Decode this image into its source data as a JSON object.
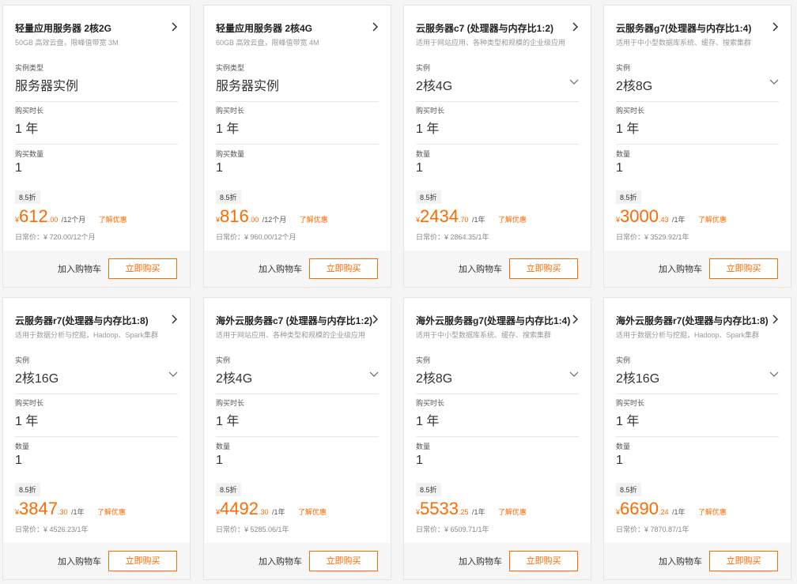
{
  "cards": [
    {
      "title": "轻量应用服务器 2核2G",
      "desc": "50GB 高效云盘，限峰值带宽 3M",
      "fields": [
        {
          "label": "实例类型",
          "value": "服务器实例",
          "dropdown": false
        },
        {
          "label": "购买时长",
          "value": "1 年",
          "dropdown": false
        },
        {
          "label": "购买数量",
          "value": "1",
          "dropdown": false
        }
      ],
      "discount": "8.5折",
      "currency": "¥",
      "price_int": "612",
      "price_dec": ".00",
      "period": "/12个月",
      "promo": "了解优惠",
      "orig": "日常价：¥ 720.00/12个月",
      "cart": "加入购物车",
      "buy": "立即购买"
    },
    {
      "title": "轻量应用服务器 2核4G",
      "desc": "60GB 高效云盘，限峰值带宽 4M",
      "fields": [
        {
          "label": "实例类型",
          "value": "服务器实例",
          "dropdown": false
        },
        {
          "label": "购买时长",
          "value": "1 年",
          "dropdown": false
        },
        {
          "label": "购买数量",
          "value": "1",
          "dropdown": false
        }
      ],
      "discount": "8.5折",
      "currency": "¥",
      "price_int": "816",
      "price_dec": ".00",
      "period": "/12个月",
      "promo": "了解优惠",
      "orig": "日常价：¥ 960.00/12个月",
      "cart": "加入购物车",
      "buy": "立即购买"
    },
    {
      "title": "云服务器c7 (处理器与内存比1:2)",
      "desc": "适用于网站应用、各种类型和规模的企业级应用",
      "fields": [
        {
          "label": "实例",
          "value": "2核4G",
          "dropdown": true
        },
        {
          "label": "购买时长",
          "value": "1 年",
          "dropdown": false
        },
        {
          "label": "数量",
          "value": "1",
          "dropdown": false
        }
      ],
      "discount": "8.5折",
      "currency": "¥",
      "price_int": "2434",
      "price_dec": ".70",
      "period": "/1年",
      "promo": "了解优惠",
      "orig": "日常价：¥ 2864.35/1年",
      "cart": "加入购物车",
      "buy": "立即购买"
    },
    {
      "title": "云服务器g7(处理器与内存比1:4)",
      "desc": "适用于中小型数据库系统、缓存、搜索集群",
      "fields": [
        {
          "label": "实例",
          "value": "2核8G",
          "dropdown": true
        },
        {
          "label": "购买时长",
          "value": "1 年",
          "dropdown": false
        },
        {
          "label": "数量",
          "value": "1",
          "dropdown": false
        }
      ],
      "discount": "8.5折",
      "currency": "¥",
      "price_int": "3000",
      "price_dec": ".43",
      "period": "/1年",
      "promo": "了解优惠",
      "orig": "日常价：¥ 3529.92/1年",
      "cart": "加入购物车",
      "buy": "立即购买"
    },
    {
      "title": "云服务器r7(处理器与内存比1:8)",
      "desc": "适用于数据分析与挖掘，Hadoop、Spark集群",
      "fields": [
        {
          "label": "实例",
          "value": "2核16G",
          "dropdown": true
        },
        {
          "label": "购买时长",
          "value": "1 年",
          "dropdown": false
        },
        {
          "label": "数量",
          "value": "1",
          "dropdown": false
        }
      ],
      "discount": "8.5折",
      "currency": "¥",
      "price_int": "3847",
      "price_dec": ".30",
      "period": "/1年",
      "promo": "了解优惠",
      "orig": "日常价：¥ 4526.23/1年",
      "cart": "加入购物车",
      "buy": "立即购买"
    },
    {
      "title": "海外云服务器c7 (处理器与内存比1:2)",
      "desc": "适用于网站应用、各种类型和规模的企业级应用",
      "fields": [
        {
          "label": "实例",
          "value": "2核4G",
          "dropdown": true
        },
        {
          "label": "购买时长",
          "value": "1 年",
          "dropdown": false
        },
        {
          "label": "数量",
          "value": "1",
          "dropdown": false
        }
      ],
      "discount": "8.5折",
      "currency": "¥",
      "price_int": "4492",
      "price_dec": ".30",
      "period": "/1年",
      "promo": "了解优惠",
      "orig": "日常价：¥ 5285.06/1年",
      "cart": "加入购物车",
      "buy": "立即购买"
    },
    {
      "title": "海外云服务器g7(处理器与内存比1:4)",
      "desc": "适用于中小型数据库系统、缓存、搜索集群",
      "fields": [
        {
          "label": "实例",
          "value": "2核8G",
          "dropdown": true
        },
        {
          "label": "购买时长",
          "value": "1 年",
          "dropdown": false
        },
        {
          "label": "数量",
          "value": "1",
          "dropdown": false
        }
      ],
      "discount": "8.5折",
      "currency": "¥",
      "price_int": "5533",
      "price_dec": ".25",
      "period": "/1年",
      "promo": "了解优惠",
      "orig": "日常价：¥ 6509.71/1年",
      "cart": "加入购物车",
      "buy": "立即购买"
    },
    {
      "title": "海外云服务器r7(处理器与内存比1:8)",
      "desc": "适用于数据分析与挖掘，Hadoop、Spark集群",
      "fields": [
        {
          "label": "实例",
          "value": "2核16G",
          "dropdown": true
        },
        {
          "label": "购买时长",
          "value": "1 年",
          "dropdown": false
        },
        {
          "label": "数量",
          "value": "1",
          "dropdown": false
        }
      ],
      "discount": "8.5折",
      "currency": "¥",
      "price_int": "6690",
      "price_dec": ".24",
      "period": "/1年",
      "promo": "了解优惠",
      "orig": "日常价：¥ 7870.87/1年",
      "cart": "加入购物车",
      "buy": "立即购买"
    }
  ]
}
